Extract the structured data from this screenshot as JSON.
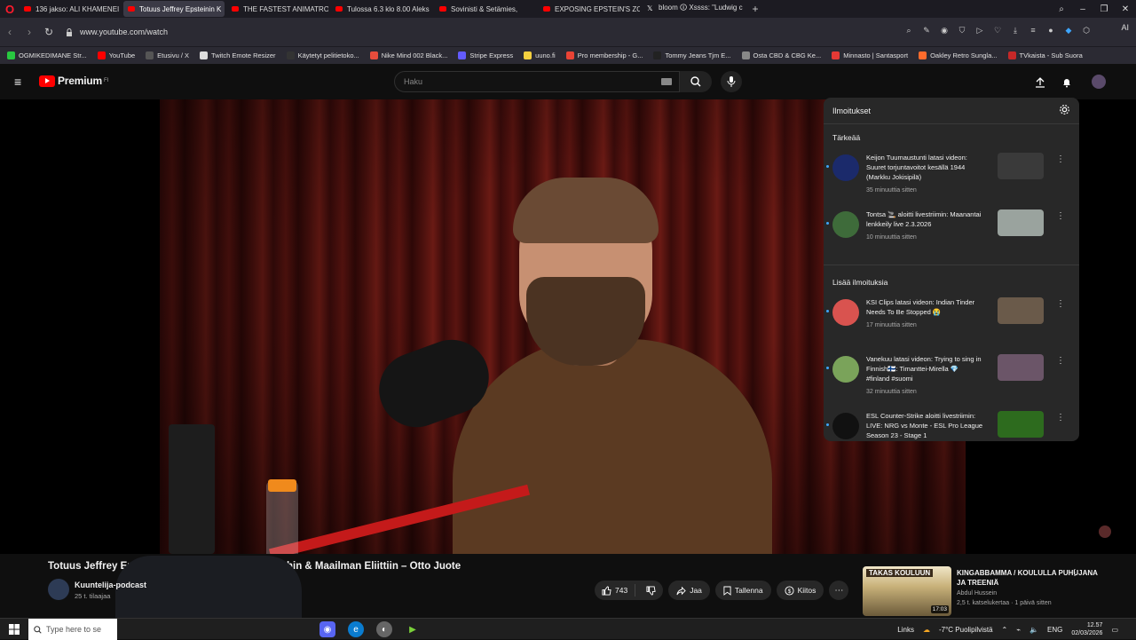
{
  "browser": {
    "tabs": [
      {
        "label": "136 jakso: ALI KHAMENEI",
        "kind": "yt"
      },
      {
        "label": "Totuus Jeffrey Epsteinin K",
        "kind": "yt",
        "active": true
      },
      {
        "label": "THE FASTEST ANIMATRON",
        "kind": "yt"
      },
      {
        "label": "Tulossa 6.3 klo 8.00 Aleks",
        "kind": "yt"
      },
      {
        "label": "Sovinisti & Setämies,",
        "kind": "yt"
      },
      {
        "label": "EXPOSING EPSTEIN'S ZOR",
        "kind": "yt"
      },
      {
        "label": "bloom 🛈 Xssss: \"Ludwig c",
        "kind": "x"
      }
    ],
    "url": "www.youtube.com/watch",
    "ai_label": "AI",
    "bookmarks": [
      {
        "label": "OGMIKEDIMANE Str...",
        "color": "#28c840"
      },
      {
        "label": "YouTube",
        "color": "#ff0000"
      },
      {
        "label": "Etusivu / X",
        "color": "#555555"
      },
      {
        "label": "Twitch Emote Resizer",
        "color": "#dddddd"
      },
      {
        "label": "Käytetyt pelitietoko...",
        "color": "#333333"
      },
      {
        "label": "Nike Mind 002 Black...",
        "color": "#e74c3c"
      },
      {
        "label": "Stripe Express",
        "color": "#635bff"
      },
      {
        "label": "uuno.fi",
        "color": "#f4d03f"
      },
      {
        "label": "Pro membership - G...",
        "color": "#ea4335"
      },
      {
        "label": "Tommy Jeans Tjm E...",
        "color": "#222222"
      },
      {
        "label": "Osta CBD & CBG Ke...",
        "color": "#888888"
      },
      {
        "label": "Minnasto | Santasport",
        "color": "#e53935"
      },
      {
        "label": "Oakley Retro Sungla...",
        "color": "#ff6b2c"
      },
      {
        "label": "TVkaista - Sub Suora",
        "color": "#c62828"
      }
    ]
  },
  "youtube": {
    "logo_text": "Premium",
    "logo_sup": "FI",
    "search_placeholder": "Haku"
  },
  "notifications": {
    "title": "Ilmoitukset",
    "section_important": "Tärkeää",
    "section_more": "Lisää ilmoituksia",
    "items": [
      {
        "text": "Keijon Tuumaustunti latasi videon: Suuret torjuntavoitot kesällä 1944 (Markku Jokisipilä)",
        "time": "35 minuuttia sitten",
        "avatar": "#1b2a6b",
        "thumb": "#3a3a3a"
      },
      {
        "text": "Tontsa 🚬 aloitti livestriimin: Maanantai lenkkeily live 2.3.2026",
        "time": "10 minuuttia sitten",
        "avatar": "#3e6b3a",
        "thumb": "#9aa39e"
      },
      {
        "text": "KSI Clips latasi videon: Indian Tinder Needs To Be Stopped 😭",
        "time": "17 minuuttia sitten",
        "avatar": "#d9534f",
        "thumb": "#6a5a4a"
      },
      {
        "text": "Vanekuu latasi videon: Trying to sing in Finnish🇫🇮: Timanttei-Mirella 💎 #finland #suomi",
        "time": "32 minuuttia sitten",
        "avatar": "#7aa35a",
        "thumb": "#6b5568"
      },
      {
        "text": "ESL Counter-Strike aloitti livestriimin: LIVE: NRG vs Monte - ESL Pro League Season 23 - Stage 1",
        "time": "",
        "avatar": "#111111",
        "thumb": "#2d6b1e"
      }
    ]
  },
  "video": {
    "title": "Totuus Jeffrey Epsteinin K",
    "title_tail": "A:hin & Maailman Eliittiin – Otto Juote",
    "channel": "Kuuntelija-podcast",
    "subs": "25 t. tilaajaa",
    "likes": "743",
    "share": "Jaa",
    "save": "Tallenna",
    "thanks": "Kiitos"
  },
  "recommendation": {
    "thumb_banner": "TAKAS KOULUUN",
    "duration": "17:03",
    "title": "KINGABBAMMA / KOULULLA PUHUJANA JA TREENIÄ",
    "channel": "Abdul Hussein",
    "meta": "2,5 t. katselukertaa · 1 päivä sitten"
  },
  "taskbar": {
    "search_placeholder": "Type here to se",
    "links": "Links",
    "weather": "-7°C  Puolipilvistä",
    "lang": "ENG",
    "time": "12.57",
    "date": "02/03/2026"
  }
}
